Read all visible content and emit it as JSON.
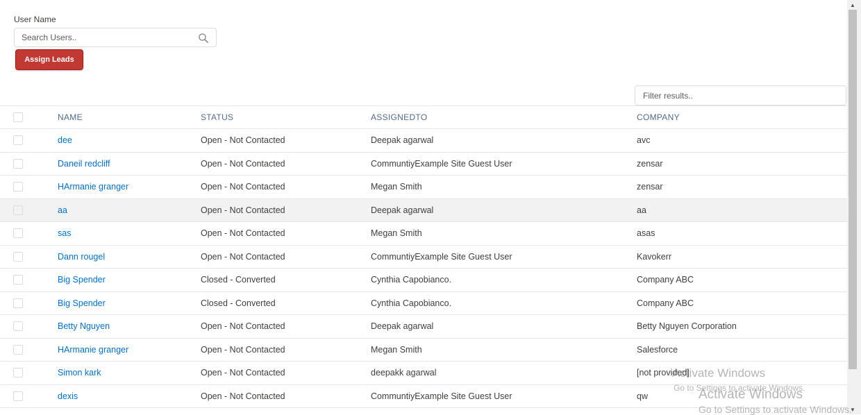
{
  "search": {
    "label": "User Name",
    "placeholder": "Search Users.."
  },
  "actions": {
    "assign_label": "Assign Leads"
  },
  "filter": {
    "placeholder": "Filter results.."
  },
  "table": {
    "columns": [
      "NAME",
      "STATUS",
      "ASSIGNEDTO",
      "COMPANY"
    ],
    "rows": [
      {
        "name": "dee",
        "status": "Open - Not Contacted",
        "assigned": "Deepak agarwal",
        "company": "avc"
      },
      {
        "name": "Daneil redcliff",
        "status": "Open - Not Contacted",
        "assigned": "CommuntiyExample Site Guest User",
        "company": "zensar"
      },
      {
        "name": "HArmanie granger",
        "status": "Open - Not Contacted",
        "assigned": "Megan Smith",
        "company": "zensar"
      },
      {
        "name": "aa",
        "status": "Open - Not Contacted",
        "assigned": "Deepak agarwal",
        "company": "aa"
      },
      {
        "name": "sas",
        "status": "Open - Not Contacted",
        "assigned": "Megan Smith",
        "company": "asas"
      },
      {
        "name": "Dann rougel",
        "status": "Open - Not Contacted",
        "assigned": "CommuntiyExample Site Guest User",
        "company": "Kavokerr"
      },
      {
        "name": "Big Spender",
        "status": "Closed - Converted",
        "assigned": "Cynthia Capobianco.",
        "company": "Company ABC"
      },
      {
        "name": "Big Spender",
        "status": "Closed - Converted",
        "assigned": "Cynthia Capobianco.",
        "company": "Company ABC"
      },
      {
        "name": "Betty Nguyen",
        "status": "Open - Not Contacted",
        "assigned": "Deepak agarwal",
        "company": "Betty Nguyen Corporation"
      },
      {
        "name": "HArmanie granger",
        "status": "Open - Not Contacted",
        "assigned": "Megan Smith",
        "company": "Salesforce"
      },
      {
        "name": "Simon kark",
        "status": "Open - Not Contacted",
        "assigned": "deepakk agarwal",
        "company": "[not provided]"
      },
      {
        "name": "dexis",
        "status": "Open - Not Contacted",
        "assigned": "CommuntiyExample Site Guest User",
        "company": "qw"
      }
    ]
  },
  "watermark": {
    "line1": "Activate Windows",
    "line2": "Go to Settings to activate Windows.",
    "line3": "Activate Windows",
    "line4": "Go to Settings to activate Windows."
  },
  "colors": {
    "accent_button": "#c23934",
    "link": "#0070d2",
    "header_text": "#54698d",
    "highlight_row": "#f3f2f2"
  }
}
